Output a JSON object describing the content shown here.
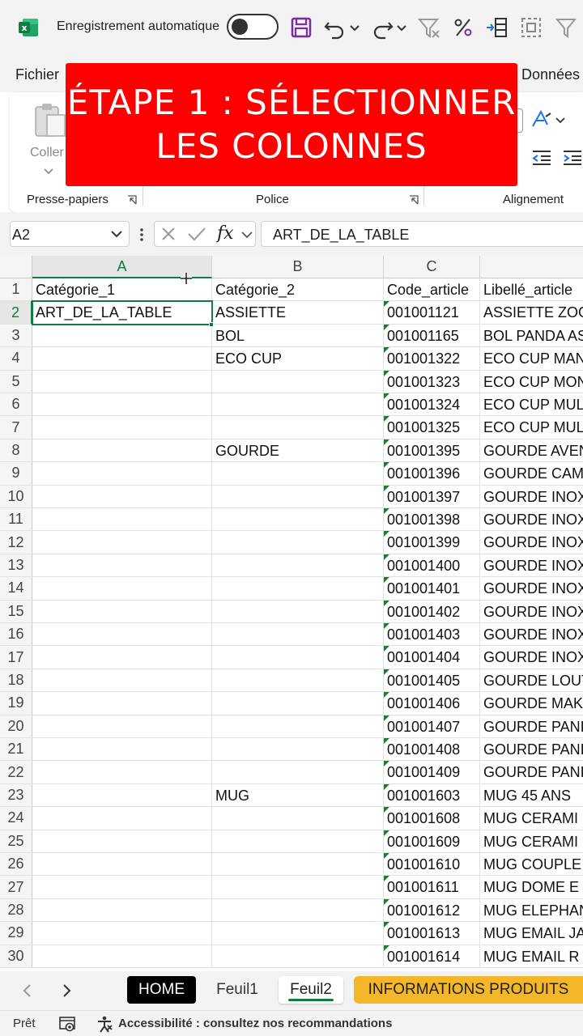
{
  "titlebar": {
    "autosave_label": "Enregistrement automatique",
    "autosave_on": false,
    "icons": [
      "excel-logo-icon",
      "save-icon",
      "undo-icon",
      "redo-icon",
      "filter-clear-icon",
      "percent-icon",
      "text-to-columns-icon",
      "select-all-icon",
      "filter-icon"
    ]
  },
  "menu_tabs": {
    "fichier": "Fichier",
    "donnees": "Données"
  },
  "ribbon": {
    "paste_label": "Coller",
    "groups": {
      "clipboard": "Presse-papiers",
      "font": "Police",
      "alignment": "Alignement"
    }
  },
  "overlay": {
    "line1": "ÉTAPE 1 : SÉLECTIONNER",
    "line2": "LES COLONNES",
    "color": "#ff0000"
  },
  "formula_bar": {
    "name_box": "A2",
    "fx": "fx",
    "value": "ART_DE_LA_TABLE"
  },
  "grid": {
    "columns": [
      "A",
      "B",
      "C"
    ],
    "active_cell": "A2",
    "rows": [
      {
        "n": "1",
        "a": "Catégorie_1",
        "b": "Catégorie_2",
        "c": "Code_article",
        "d": "Libellé_article"
      },
      {
        "n": "2",
        "a": "ART_DE_LA_TABLE",
        "b": "ASSIETTE",
        "c": "001001121",
        "d": "ASSIETTE ZOO"
      },
      {
        "n": "3",
        "a": "",
        "b": "BOL",
        "c": "001001165",
        "d": "BOL PANDA AS"
      },
      {
        "n": "4",
        "a": "",
        "b": "ECO CUP",
        "c": "001001322",
        "d": "ECO CUP MAN"
      },
      {
        "n": "5",
        "a": "",
        "b": "",
        "c": "001001323",
        "d": "ECO CUP MON"
      },
      {
        "n": "6",
        "a": "",
        "b": "",
        "c": "001001324",
        "d": "ECO CUP MUL"
      },
      {
        "n": "7",
        "a": "",
        "b": "",
        "c": "001001325",
        "d": "ECO CUP MUL"
      },
      {
        "n": "8",
        "a": "",
        "b": "GOURDE",
        "c": "001001395",
        "d": "GOURDE AVEN"
      },
      {
        "n": "9",
        "a": "",
        "b": "",
        "c": "001001396",
        "d": "GOURDE CAM"
      },
      {
        "n": "10",
        "a": "",
        "b": "",
        "c": "001001397",
        "d": "GOURDE INOX"
      },
      {
        "n": "11",
        "a": "",
        "b": "",
        "c": "001001398",
        "d": "GOURDE INOX"
      },
      {
        "n": "12",
        "a": "",
        "b": "",
        "c": "001001399",
        "d": "GOURDE INOX"
      },
      {
        "n": "13",
        "a": "",
        "b": "",
        "c": "001001400",
        "d": "GOURDE INOX"
      },
      {
        "n": "14",
        "a": "",
        "b": "",
        "c": "001001401",
        "d": "GOURDE INOX"
      },
      {
        "n": "15",
        "a": "",
        "b": "",
        "c": "001001402",
        "d": "GOURDE INOX"
      },
      {
        "n": "16",
        "a": "",
        "b": "",
        "c": "001001403",
        "d": "GOURDE INOX"
      },
      {
        "n": "17",
        "a": "",
        "b": "",
        "c": "001001404",
        "d": "GOURDE INOX"
      },
      {
        "n": "18",
        "a": "",
        "b": "",
        "c": "001001405",
        "d": "GOURDE LOUT"
      },
      {
        "n": "19",
        "a": "",
        "b": "",
        "c": "001001406",
        "d": "GOURDE MAK"
      },
      {
        "n": "20",
        "a": "",
        "b": "",
        "c": "001001407",
        "d": "GOURDE PANI"
      },
      {
        "n": "21",
        "a": "",
        "b": "",
        "c": "001001408",
        "d": "GOURDE PANI"
      },
      {
        "n": "22",
        "a": "",
        "b": "",
        "c": "001001409",
        "d": "GOURDE PANI"
      },
      {
        "n": "23",
        "a": "",
        "b": "MUG",
        "c": "001001603",
        "d": "MUG 45 ANS"
      },
      {
        "n": "24",
        "a": "",
        "b": "",
        "c": "001001608",
        "d": "MUG CERAMI"
      },
      {
        "n": "25",
        "a": "",
        "b": "",
        "c": "001001609",
        "d": "MUG CERAMI"
      },
      {
        "n": "26",
        "a": "",
        "b": "",
        "c": "001001610",
        "d": "MUG COUPLE"
      },
      {
        "n": "27",
        "a": "",
        "b": "",
        "c": "001001611",
        "d": "MUG DOME E"
      },
      {
        "n": "28",
        "a": "",
        "b": "",
        "c": "001001612",
        "d": "MUG ELEPHAN"
      },
      {
        "n": "29",
        "a": "",
        "b": "",
        "c": "001001613",
        "d": "MUG EMAIL JA"
      },
      {
        "n": "30",
        "a": "",
        "b": "",
        "c": "001001614",
        "d": "MUG EMAIL R"
      }
    ]
  },
  "sheet_tabs": {
    "home": "HOME",
    "feuil1": "Feuil1",
    "feuil2": "Feuil2",
    "info": "INFORMATIONS PRODUITS",
    "active": "Feuil2"
  },
  "status": {
    "ready": "Prêt",
    "accessibility": "Accessibilité : consultez nos recommandations"
  },
  "colors": {
    "excel_green": "#107c41",
    "info_tab": "#f4b72a",
    "save_purple": "#7b2d9b"
  }
}
